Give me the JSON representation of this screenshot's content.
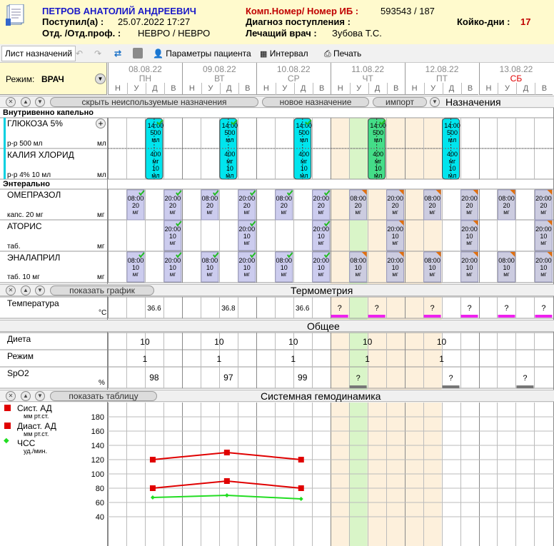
{
  "header": {
    "patient_name": "ПЕТРОВ АНАТОЛИЙ АНДРЕЕВИЧ",
    "admitted_label": "Поступил(а) :",
    "admitted_value": "25.07.2022 17:27",
    "dept_label": "Отд. /Отд.проф. :",
    "dept_value": "НЕВРО / НЕВРО",
    "comp_number_label": "Комп.Номер/ Номер ИБ :",
    "comp_number_value": "593543 / 187",
    "diagnosis_label": "Диагноз поступления :",
    "doctor_label": "Лечащий врач :",
    "doctor_value": "Зубова Т.С.",
    "bed_days_label": "Койко-дни :",
    "bed_days_value": "17"
  },
  "toolbar": {
    "tab_label": "Лист назначений",
    "patient_params_label": "Параметры пациента",
    "interval_label": "Интервал",
    "print_label": "Печать"
  },
  "mode": {
    "label": "Режим:",
    "value": "ВРАЧ"
  },
  "days": [
    {
      "date": "08.08.22",
      "weekday": "ПН"
    },
    {
      "date": "09.08.22",
      "weekday": "ВТ"
    },
    {
      "date": "10.08.22",
      "weekday": "СР"
    },
    {
      "date": "11.08.22",
      "weekday": "ЧТ"
    },
    {
      "date": "12.08.22",
      "weekday": "ПТ"
    },
    {
      "date": "13.08.22",
      "weekday": "СБ"
    }
  ],
  "slots": [
    "Н",
    "У",
    "Д",
    "В"
  ],
  "assignments_bar": {
    "hide_button": "скрыть неиспользуемые назначения",
    "new_button": "новое назначение",
    "import_button": "импорт",
    "title": "Назначения"
  },
  "groups": {
    "iv": "Внутривенно капельно",
    "enteral": "Энтерально"
  },
  "iv_drugs": [
    {
      "name": "ГЛЮКОЗА 5%",
      "form": "р-р 500 мл",
      "unit": "мл",
      "dose_lines": [
        "14:00",
        "500",
        "мл"
      ]
    },
    {
      "name": "КАЛИЯ ХЛОРИД",
      "form": "р-р 4% 10 мл",
      "unit": "мл",
      "dose_lines": [
        "400",
        "мг",
        "10",
        "мл"
      ]
    }
  ],
  "enteral_drugs": [
    {
      "name": "ОМЕПРАЗОЛ",
      "form": "капс. 20 мг",
      "unit": "мг"
    },
    {
      "name": "АТОРИС",
      "form": "таб.",
      "unit": "мг"
    },
    {
      "name": "ЭНАЛАПРИЛ",
      "form": "таб. 10 мг",
      "unit": "мг"
    }
  ],
  "dose_text": {
    "t08": "08:00",
    "t20": "20:00",
    "d20": "20",
    "d10": "10",
    "mg": "мг"
  },
  "thermo_bar": {
    "show_button": "показать график",
    "title": "Термометрия"
  },
  "temperature": {
    "label": "Температура",
    "unit": "°С",
    "values": [
      "36.6",
      "36.8",
      "36.6"
    ],
    "pending": "?"
  },
  "general_bar": {
    "title": "Общее"
  },
  "diet": {
    "label": "Диета",
    "values": [
      "10",
      "10",
      "10",
      "10",
      "10"
    ]
  },
  "regime": {
    "label": "Режим",
    "values": [
      "1",
      "1",
      "1",
      "1",
      "1"
    ]
  },
  "spo2": {
    "label": "SpO2",
    "unit": "%",
    "values": [
      "98",
      "97",
      "99"
    ],
    "pending": "?"
  },
  "hemo_bar": {
    "show_button": "показать таблицу",
    "title": "Системная гемодинамика"
  },
  "legend": [
    {
      "name": "Сист. АД",
      "unit": "мм рт.ст.",
      "color": "#e00000"
    },
    {
      "name": "Диаст. АД",
      "unit": "мм рт.ст.",
      "color": "#e00000"
    },
    {
      "name": "ЧСС",
      "unit": "уд./мин.",
      "color": "#22dd22"
    }
  ],
  "chart_data": {
    "type": "line",
    "x": [
      "08.08.22",
      "09.08.22",
      "10.08.22"
    ],
    "ylim": [
      40,
      190
    ],
    "yticks": [
      "180",
      "160",
      "140",
      "120",
      "100",
      "80",
      "60",
      "40"
    ],
    "series": [
      {
        "name": "Сист. АД",
        "values": [
          120,
          130,
          120
        ],
        "color": "#e00000"
      },
      {
        "name": "Диаст. АД",
        "values": [
          80,
          90,
          80
        ],
        "color": "#e00000"
      },
      {
        "name": "ЧСС",
        "values": [
          67,
          70,
          65
        ],
        "color": "#22dd22"
      }
    ]
  },
  "colors": {
    "header_bg": "#fffacd",
    "today_col": "#d9f5c8",
    "future_col": "#fdf0dc",
    "iv_done": "#00e5ee",
    "iv_today": "#44dd88",
    "enteral_done": "#ccccee",
    "enteral_future": "#cccce0",
    "pending_bar": "#ee22ee",
    "saturday": "#e00000"
  }
}
